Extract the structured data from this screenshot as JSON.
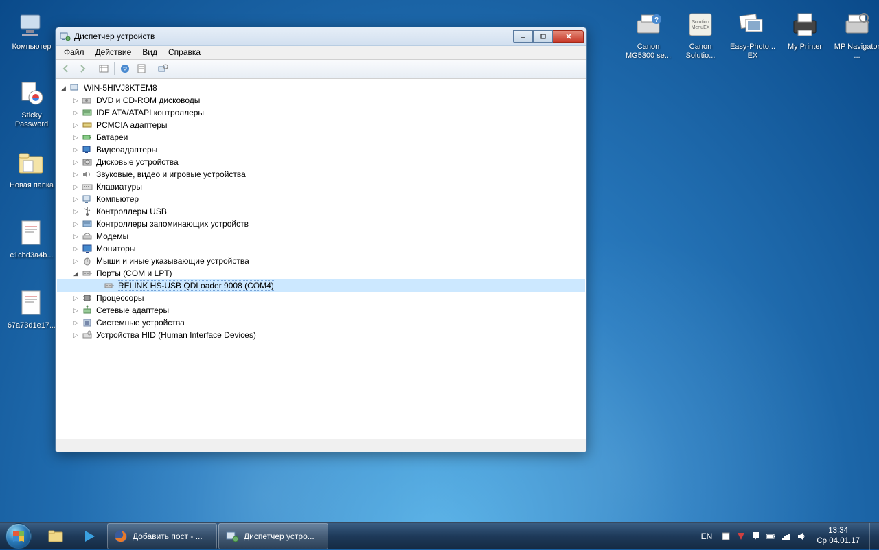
{
  "desktop": {
    "left_icons": [
      {
        "name": "computer-icon",
        "label": "Компьютер"
      },
      {
        "name": "sticky-password-icon",
        "label": "Sticky Password"
      },
      {
        "name": "folder-icon",
        "label": "Новая папка"
      },
      {
        "name": "file-icon-1",
        "label": "c1cbd3a4b..."
      },
      {
        "name": "file-icon-2",
        "label": "67a73d1e17..."
      }
    ],
    "right_icons": [
      {
        "name": "canon-mg-icon",
        "label": "Canon MG5300 se..."
      },
      {
        "name": "canon-solution-icon",
        "label": "Canon Solutio..."
      },
      {
        "name": "easy-photo-icon",
        "label": "Easy-Photo... EX"
      },
      {
        "name": "my-printer-icon",
        "label": "My Printer"
      },
      {
        "name": "mp-navigator-icon",
        "label": "MP Navigator ..."
      }
    ]
  },
  "window": {
    "title": "Диспетчер устройств",
    "menu": [
      "Файл",
      "Действие",
      "Вид",
      "Справка"
    ]
  },
  "tree": {
    "root": "WIN-5HIVJ8KTEM8",
    "categories": [
      {
        "label": "DVD и CD-ROM дисководы",
        "icon": "disc-drive-icon"
      },
      {
        "label": "IDE ATA/ATAPI контроллеры",
        "icon": "ide-icon"
      },
      {
        "label": "PCMCIA адаптеры",
        "icon": "pcmcia-icon"
      },
      {
        "label": "Батареи",
        "icon": "battery-icon"
      },
      {
        "label": "Видеоадаптеры",
        "icon": "display-adapter-icon"
      },
      {
        "label": "Дисковые устройства",
        "icon": "disk-icon"
      },
      {
        "label": "Звуковые, видео и игровые устройства",
        "icon": "audio-icon"
      },
      {
        "label": "Клавиатуры",
        "icon": "keyboard-icon"
      },
      {
        "label": "Компьютер",
        "icon": "computer-node-icon"
      },
      {
        "label": "Контроллеры USB",
        "icon": "usb-icon"
      },
      {
        "label": "Контроллеры запоминающих устройств",
        "icon": "storage-controller-icon"
      },
      {
        "label": "Модемы",
        "icon": "modem-icon"
      },
      {
        "label": "Мониторы",
        "icon": "monitor-icon"
      },
      {
        "label": "Мыши и иные указывающие устройства",
        "icon": "mouse-icon"
      },
      {
        "label": "Порты (COM и LPT)",
        "icon": "port-icon",
        "expanded": true,
        "children": [
          {
            "label": "RELINK HS-USB QDLoader 9008 (COM4)",
            "icon": "port-icon",
            "selected": true
          }
        ]
      },
      {
        "label": "Процессоры",
        "icon": "cpu-icon"
      },
      {
        "label": "Сетевые адаптеры",
        "icon": "network-icon"
      },
      {
        "label": "Системные устройства",
        "icon": "system-device-icon"
      },
      {
        "label": "Устройства HID (Human Interface Devices)",
        "icon": "hid-icon"
      }
    ]
  },
  "taskbar": {
    "tasks": [
      {
        "label": "Добавить пост - ...",
        "icon": "firefox-icon"
      },
      {
        "label": "Диспетчер устро...",
        "icon": "device-manager-icon",
        "active": true
      }
    ],
    "lang": "EN",
    "time": "13:34",
    "date": "Ср 04.01.17"
  }
}
